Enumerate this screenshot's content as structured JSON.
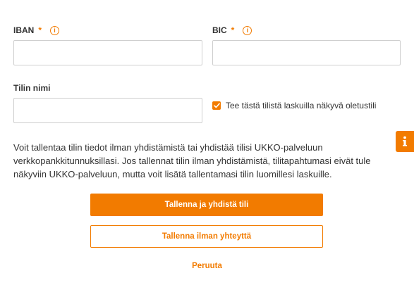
{
  "form": {
    "iban": {
      "label": "IBAN",
      "required_mark": "*",
      "value": "",
      "placeholder": ""
    },
    "bic": {
      "label": "BIC",
      "required_mark": "*",
      "value": "",
      "placeholder": ""
    },
    "account_name": {
      "label": "Tilin nimi",
      "value": "",
      "placeholder": ""
    },
    "default_checkbox": {
      "label": "Tee tästä tilistä laskuilla näkyvä oletustili",
      "checked": true
    },
    "info_icon_glyph": "i",
    "description": "Voit tallentaa tilin tiedot ilman yhdistämistä tai yhdistää tilisi UKKO-palveluun verkkopankkitunnuksillasi. Jos tallennat tilin ilman yhdistämistä, tilitapahtumasi eivät tule näkyviin UKKO-palveluun, mutta voit lisätä tallentamasi tilin luomillesi laskuille."
  },
  "actions": {
    "save_and_connect_label": "Tallenna ja yhdistä tili",
    "save_without_connection_label": "Tallenna ilman yhteyttä",
    "cancel_label": "Peruuta"
  },
  "side_tab": {
    "icon": "info-icon",
    "glyph": "i"
  },
  "colors": {
    "accent": "#f27b00",
    "input_border": "#cfcfcf",
    "text": "#333333",
    "background": "#ffffff"
  }
}
